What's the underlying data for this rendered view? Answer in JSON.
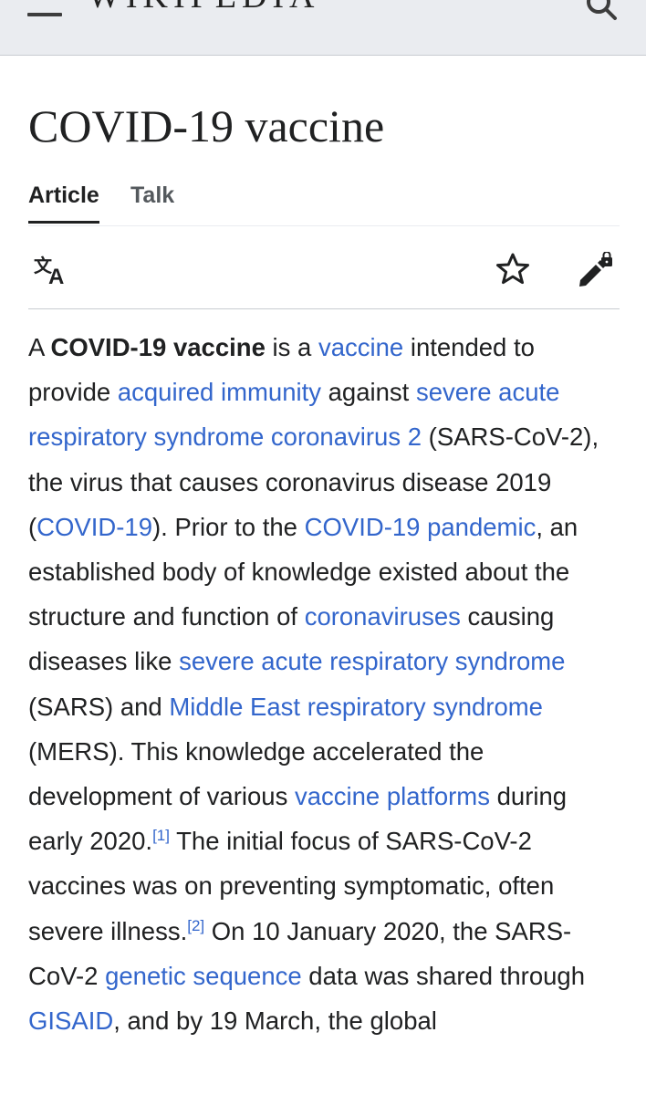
{
  "header": {
    "wordmark": "WIKIPEDIA",
    "menu_icon": "hamburger-menu-icon",
    "search_icon": "search-icon"
  },
  "page": {
    "title": "COVID-19 vaccine",
    "tabs": [
      {
        "label": "Article",
        "active": true
      },
      {
        "label": "Talk",
        "active": false
      }
    ]
  },
  "toolbar": {
    "language_icon": "language-icon",
    "watch_icon": "star-icon",
    "edit_icon": "edit-locked-icon"
  },
  "article": {
    "segments": [
      {
        "t": "A "
      },
      {
        "t": "COVID-19 vaccine",
        "bold": true
      },
      {
        "t": " is a "
      },
      {
        "t": "vaccine",
        "link": true
      },
      {
        "t": " intended to provide "
      },
      {
        "t": "acquired immunity",
        "link": true
      },
      {
        "t": " against "
      },
      {
        "t": "severe acute respiratory syndrome coronavirus 2",
        "link": true
      },
      {
        "t": " (SARS-CoV-2), the virus that causes coronavirus disease 2019 ("
      },
      {
        "t": "COVID-19",
        "link": true
      },
      {
        "t": "). Prior to the "
      },
      {
        "t": "COVID-19 pandemic",
        "link": true
      },
      {
        "t": ", an established body of knowledge existed about the structure and function of "
      },
      {
        "t": "coronaviruses",
        "link": true
      },
      {
        "t": " causing diseases like "
      },
      {
        "t": "severe acute respiratory syndrome",
        "link": true
      },
      {
        "t": " (SARS) and "
      },
      {
        "t": "Middle East respiratory syndrome",
        "link": true
      },
      {
        "t": " (MERS). This knowledge accelerated the development of various "
      },
      {
        "t": "vaccine platforms",
        "link": true
      },
      {
        "t": " during early 2020."
      },
      {
        "t": "[1]",
        "ref": true
      },
      {
        "t": " The initial focus of SARS-CoV-2 vaccines was on preventing symptomatic, often severe illness."
      },
      {
        "t": "[2]",
        "ref": true
      },
      {
        "t": " On 10 January 2020, the SARS-CoV-2 "
      },
      {
        "t": "genetic sequence",
        "link": true
      },
      {
        "t": " data was shared through "
      },
      {
        "t": "GISAID",
        "link": true
      },
      {
        "t": ", and by 19 March, the global"
      }
    ]
  },
  "colors": {
    "link": "#3366cc",
    "text": "#202122",
    "header_bg": "#eaecf0"
  }
}
